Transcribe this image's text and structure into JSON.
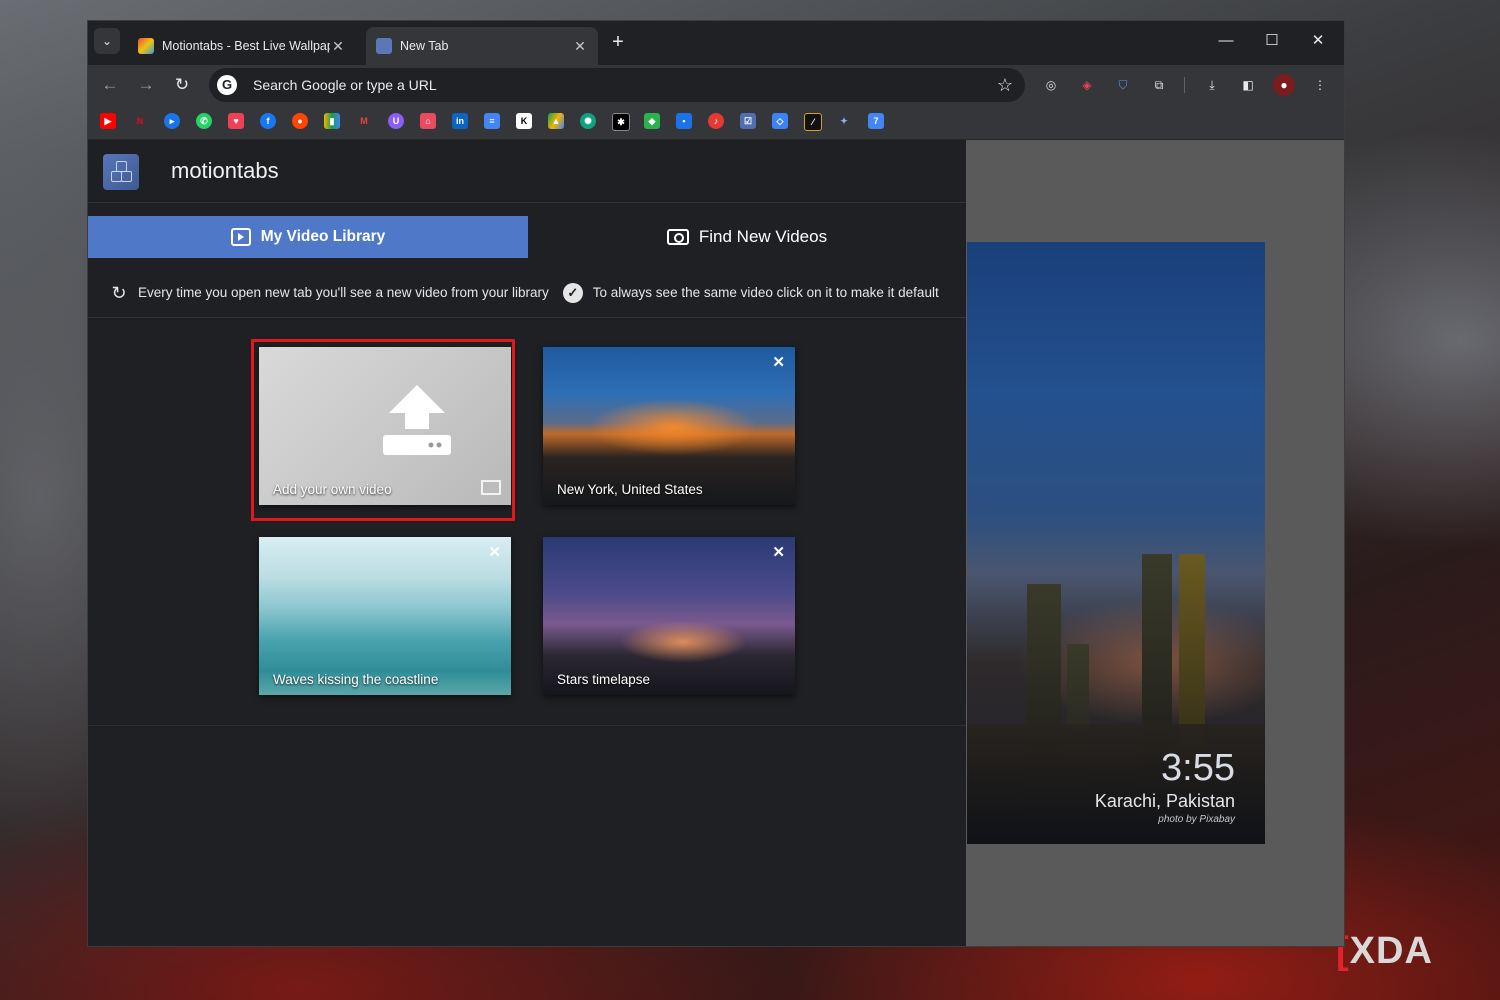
{
  "watermark": {
    "bracket": "[",
    "text": "XDA"
  },
  "browser": {
    "tabs": [
      {
        "title": "Motiontabs - Best Live Wallpap",
        "favicon": "motiontabs-favicon",
        "active": false
      },
      {
        "title": "New Tab",
        "favicon": "motiontabs-favicon",
        "active": true
      }
    ],
    "new_tab_symbol": "+",
    "window_controls": {
      "minimize": "—",
      "maximize": "☐",
      "close": "✕"
    },
    "omnibox": {
      "placeholder": "Search Google or type a URL",
      "value": ""
    },
    "nav": {
      "back": "←",
      "forward": "→",
      "reload": "↻"
    },
    "bookmarks_icons": [
      "youtube",
      "netflix",
      "play",
      "whatsapp",
      "pocket",
      "facebook",
      "reddit",
      "analytics",
      "gmail",
      "proton",
      "store",
      "linkedin",
      "docs",
      "notion",
      "drive",
      "chatgpt",
      "bard",
      "feedly",
      "chat",
      "music",
      "tasks",
      "dropbox",
      "glasses",
      "gemini",
      "calendar"
    ]
  },
  "app": {
    "brand": "motiontabs",
    "tabs": {
      "library": "My Video Library",
      "find": "Find New Videos"
    },
    "info": {
      "left": "Every time you open new tab you'll see a new video from your library",
      "right": "To always see the same video click on it to make it default"
    },
    "cards": [
      {
        "label": "Add your own video",
        "closable": false
      },
      {
        "label": "New York, United States",
        "closable": true
      },
      {
        "label": "Waves kissing the coastline",
        "closable": true
      },
      {
        "label": "Stars timelapse",
        "closable": true
      }
    ],
    "close_symbol": "✕"
  },
  "preview": {
    "time": "3:55",
    "location": "Karachi, Pakistan",
    "credit": "photo by Pixabay"
  },
  "colors": {
    "accent": "#4f78c8",
    "highlight": "#e0181e",
    "panel": "#1f2023"
  }
}
